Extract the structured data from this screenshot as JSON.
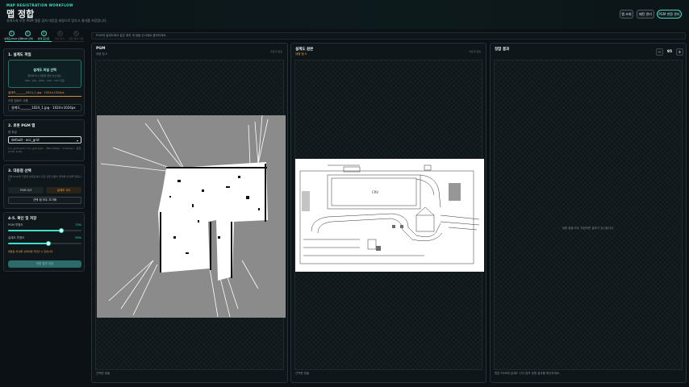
{
  "header": {
    "eyebrow": "MAP REGISTRATION WORKFLOW",
    "title": "맵 정합",
    "subtitle": "설계도와 로봇 PGM 맵을 겹쳐 대응점 세쌍으로 맞추고 결과를 저장합니다.",
    "buttons": [
      "맵 조회",
      "패턴 관리",
      "PGM 변환 관리"
    ]
  },
  "steps": [
    {
      "num": "1",
      "label": "설계도/PGM 선택"
    },
    {
      "num": "2",
      "label": "PGM 선택"
    },
    {
      "num": "3",
      "label": "선택 포인트"
    },
    {
      "num": "4",
      "label": "미리 보기"
    },
    {
      "num": "5",
      "label": "정합 결과 저장"
    }
  ],
  "hint": "PGM과 설계도에서 같은 위치 세 쌍을 순서대로 클릭하세요.",
  "left": {
    "s1_title": "1. 설계도 파일",
    "upload_main": "설계도 파일 선택",
    "upload_sub1": "클릭하거나 파일을 끌어 놓으세요.",
    "upload_sub2": "PNG · JPG · JPEG · SVG · DXF 지원",
    "file_name": "설계도_______2024_1.jpg · 1024×1024px",
    "recent_label": "이전 업로드 사용",
    "recent_value": "설계도_______1024_1.jpg · 1024×1024px",
    "s2_title": "2. 로봇 PGM 맵",
    "map_label": "맵 파일",
    "map_value": "default · occ_grid",
    "map_note": "occ_grid.yaml / occ_grid.pgm · 384×402px · 0.05m/px · 원점 (0.00, 0.00)",
    "s3_title": "3. 대응점 선택",
    "s3_note": "왼쪽 PGM과 가운데 설계도에서 같은 곳을 번갈아 클릭해 세 쌍을 맞춥니다.",
    "pgm_count": "PGM 0/3",
    "plan_count": "설계도 0/3",
    "reset_label": "선택 점 모두 초기화",
    "s4_title": "4-5. 확인 및 저장",
    "pgm_opacity_label": "PGM 투명도",
    "pgm_opacity_text": "72%",
    "pgm_opacity": 0.72,
    "plan_opacity_label": "설계도 투명도",
    "plan_opacity_text": "55%",
    "plan_opacity": 0.55,
    "save_note": "대응점 세 쌍을 선택하면 저장할 수 있습니다.",
    "save_label": "정합 결과 저장"
  },
  "panels": {
    "pgm": {
      "title": "PGM",
      "subtitle": "대응 점 0",
      "right": "좌표계 원점",
      "footer": "선택한 점들"
    },
    "plan": {
      "title": "설계도 원본",
      "subtitle": "대응 점 0",
      "right": "좌표계 원점",
      "footer": "선택한 점들"
    },
    "result": {
      "title": "정합 결과",
      "zoom": "95",
      "empty": "대응 점을 모두 지정하면 결과가 표시됩니다.",
      "footer": "원본 PGM에 설계도 선이 겹쳐 정합 결과를 확인하세요."
    }
  },
  "colors": {
    "accent": "#3ce0c4",
    "warning": "#f0a24a",
    "background": "#0b1114"
  },
  "icons": {
    "plus": "plus-icon",
    "minus": "minus-icon",
    "chevron": "chevron-down-icon"
  }
}
